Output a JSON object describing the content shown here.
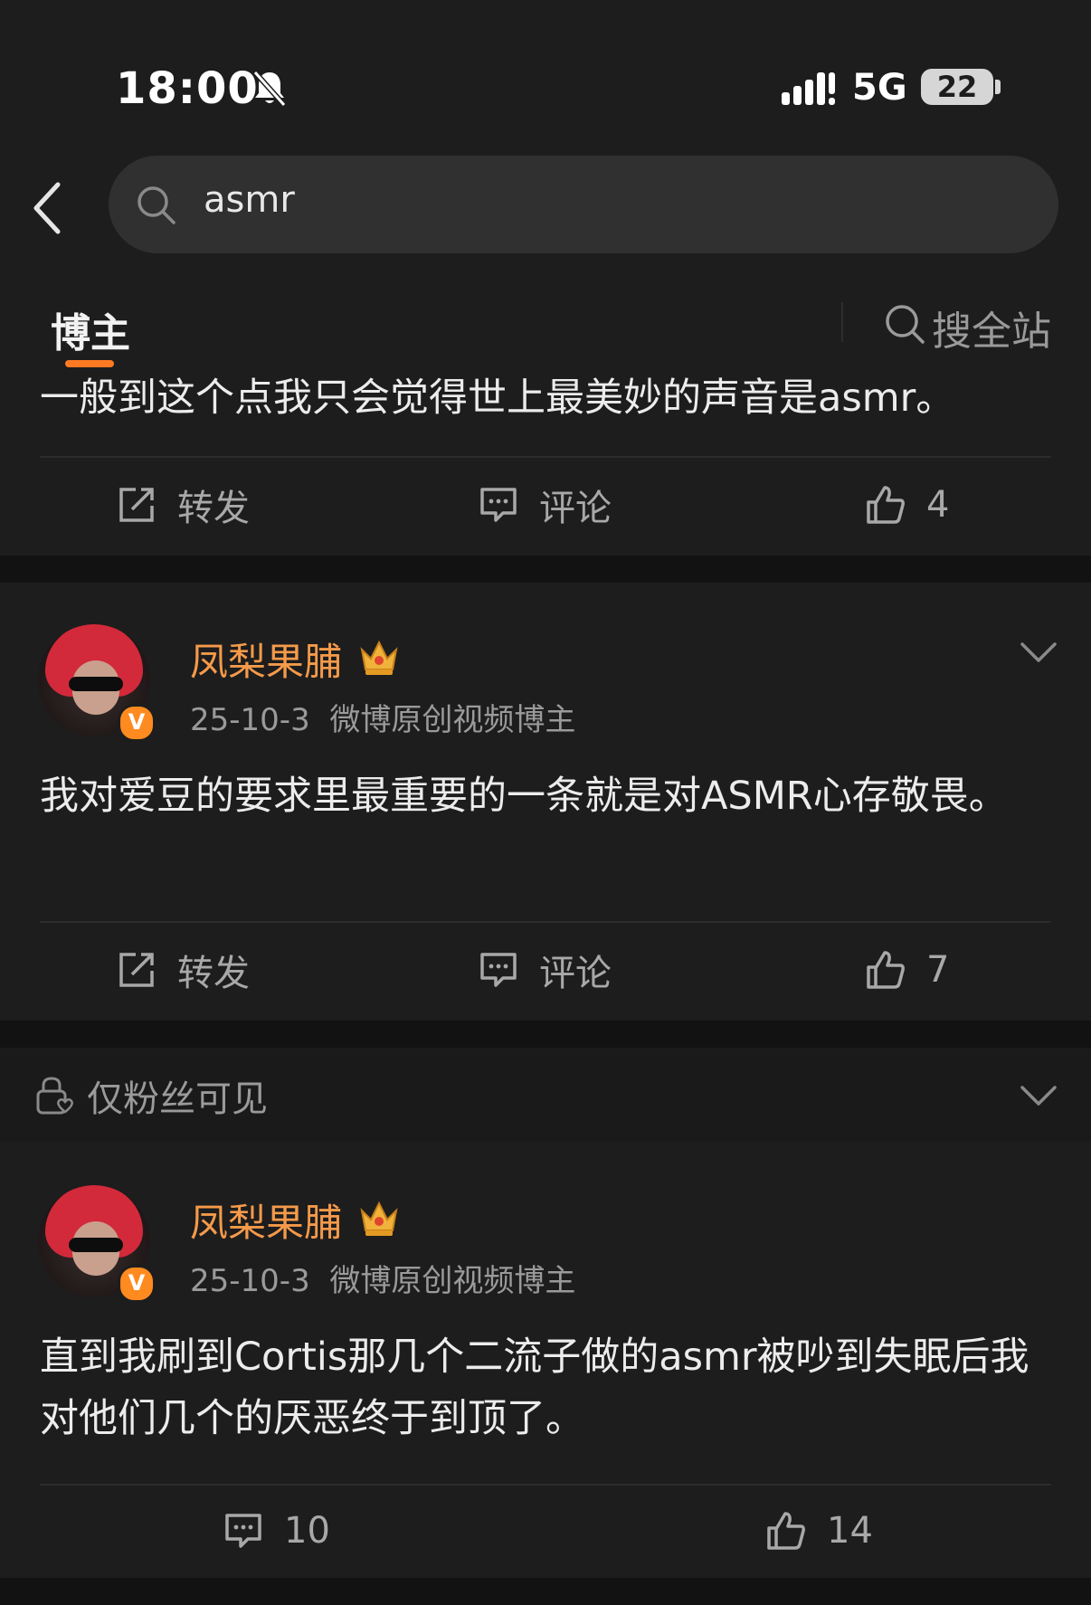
{
  "status_bar": {
    "time": "18:00",
    "network": "5G",
    "battery": "22"
  },
  "search": {
    "query": "asmr"
  },
  "tabs": {
    "active": "博主",
    "site_search": "搜全站"
  },
  "posts": [
    {
      "text": "一般到这个点我只会觉得世上最美妙的声音是asmr。",
      "actions": {
        "repost": "转发",
        "comment": "评论",
        "likes": "4"
      }
    },
    {
      "author": "凤梨果脯",
      "date": "25-10-3",
      "role": "微博原创视频博主",
      "text": "我对爱豆的要求里最重要的一条就是对ASMR心存敬畏。",
      "actions": {
        "repost": "转发",
        "comment": "评论",
        "likes": "7"
      }
    },
    {
      "visibility": "仅粉丝可见",
      "author": "凤梨果脯",
      "date": "25-10-3",
      "role": "微博原创视频博主",
      "text": "直到我刷到Cortis那几个二流子做的asmr被吵到失眠后我对他们几个的厌恶终于到顶了。",
      "actions": {
        "comments": "10",
        "likes": "14"
      }
    }
  ],
  "colors": {
    "accent": "#ff7a22",
    "username": "#f59a4a",
    "background": "#1d1d1d",
    "vip_badge": "#ff8a1f"
  },
  "icons": [
    "back-icon",
    "search-icon",
    "mute-bell-icon",
    "signal-icon",
    "repost-icon",
    "comment-icon",
    "like-icon",
    "crown-icon",
    "chevron-down-icon",
    "fans-lock-icon"
  ]
}
